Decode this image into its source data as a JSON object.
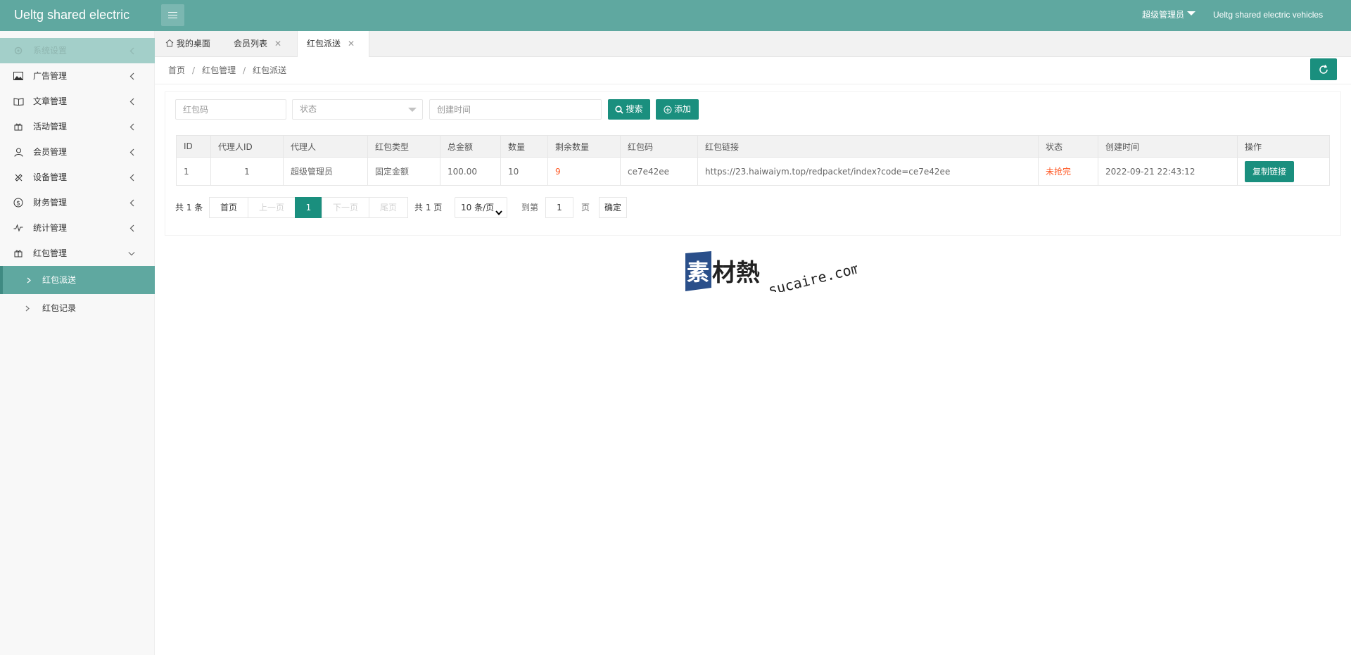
{
  "header": {
    "title": "Ueltg shared electric",
    "user": "超级管理员",
    "site": "Ueltg shared electric vehicles"
  },
  "sidebar": {
    "items": [
      {
        "label": "系统设置",
        "icon": "gear-icon"
      },
      {
        "label": "广告管理",
        "icon": "image-icon"
      },
      {
        "label": "文章管理",
        "icon": "book-icon"
      },
      {
        "label": "活动管理",
        "icon": "gift-icon"
      },
      {
        "label": "会员管理",
        "icon": "user-icon"
      },
      {
        "label": "设备管理",
        "icon": "wrench-icon"
      },
      {
        "label": "财务管理",
        "icon": "dollar-icon"
      },
      {
        "label": "统计管理",
        "icon": "pulse-icon"
      },
      {
        "label": "红包管理",
        "icon": "gift-icon"
      }
    ],
    "sub_items": [
      {
        "label": "红包派送"
      },
      {
        "label": "红包记录"
      }
    ]
  },
  "tabs": [
    {
      "label": "我的桌面"
    },
    {
      "label": "会员列表"
    },
    {
      "label": "红包派送"
    }
  ],
  "breadcrumb": [
    "首页",
    "红包管理",
    "红包派送"
  ],
  "filters": {
    "code_placeholder": "红包码",
    "status_placeholder": "状态",
    "time_placeholder": "创建时间",
    "search_label": "搜索",
    "add_label": "添加"
  },
  "table": {
    "columns": [
      "ID",
      "代理人ID",
      "代理人",
      "红包类型",
      "总金额",
      "数量",
      "剩余数量",
      "红包码",
      "红包链接",
      "状态",
      "创建时间",
      "操作"
    ],
    "rows": [
      {
        "id": "1",
        "agent_id": "1",
        "agent": "超级管理员",
        "type": "固定金额",
        "total": "100.00",
        "count": "10",
        "remaining": "9",
        "code": "ce7e42ee",
        "link": "https://23.haiwaiym.top/redpacket/index?code=ce7e42ee",
        "status": "未抢完",
        "created": "2022-09-21 22:43:12",
        "action": "复制链接"
      }
    ]
  },
  "pager": {
    "total_text": "共 1 条",
    "first": "首页",
    "prev": "上一页",
    "current": "1",
    "next": "下一页",
    "last": "尾页",
    "pages_text": "共 1 页",
    "size": "10 条/页",
    "goto": "到第",
    "goto_value": "1",
    "page_unit": "页",
    "confirm": "确定"
  },
  "watermark": {
    "mark": "素材熱",
    "domain": "sucaire.com"
  },
  "colors": {
    "header": "#5fa8a0",
    "primary": "#1a8f7e",
    "danger": "#ff5722"
  }
}
